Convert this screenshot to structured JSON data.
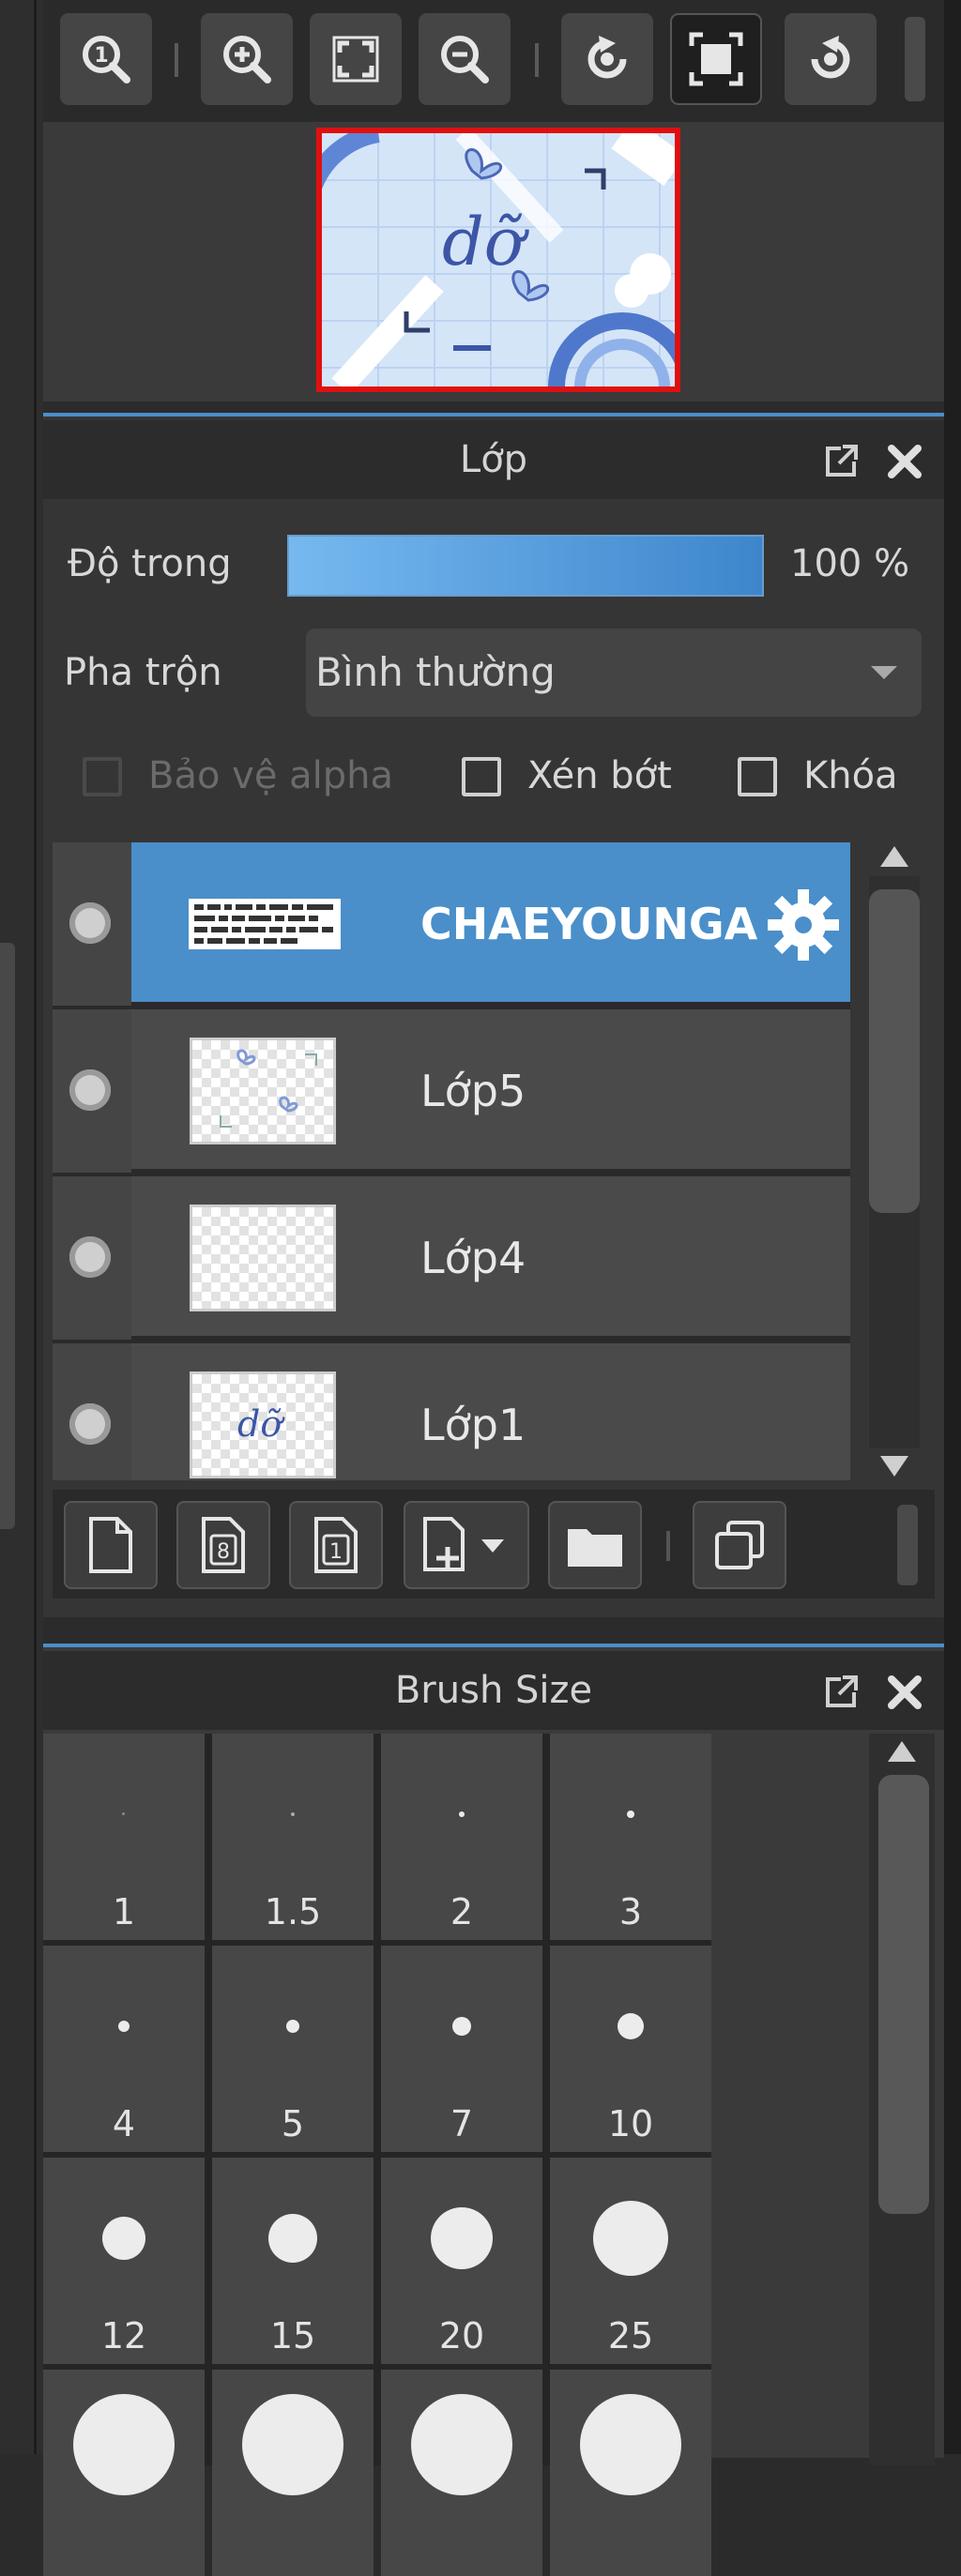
{
  "navigator": {
    "toolbar_icons": [
      "zoom-actual-icon",
      "zoom-in-icon",
      "fit-screen-icon",
      "zoom-out-icon",
      "rotate-left-icon",
      "fullscreen-icon",
      "rotate-right-icon"
    ]
  },
  "layers_panel": {
    "title": "Lớp",
    "opacity_label": "Độ trong",
    "opacity_value": "100 %",
    "opacity_fraction": 1.0,
    "blend_label": "Pha trộn",
    "blend_value": "Bình thường",
    "options": {
      "alpha_protect": "Bảo vệ alpha",
      "clip": "Xén bớt",
      "lock": "Khóa"
    },
    "layers": [
      {
        "name": "CHAEYOUNGA",
        "selected": true
      },
      {
        "name": "Lớp5",
        "selected": false
      },
      {
        "name": "Lớp4",
        "selected": false
      },
      {
        "name": "Lớp1",
        "selected": false
      }
    ],
    "accent_color": "#4a8fc9"
  },
  "brush_panel": {
    "title": "Brush Size",
    "sizes": [
      "1",
      "1.5",
      "2",
      "3",
      "4",
      "5",
      "7",
      "10",
      "12",
      "15",
      "20",
      "25"
    ]
  }
}
